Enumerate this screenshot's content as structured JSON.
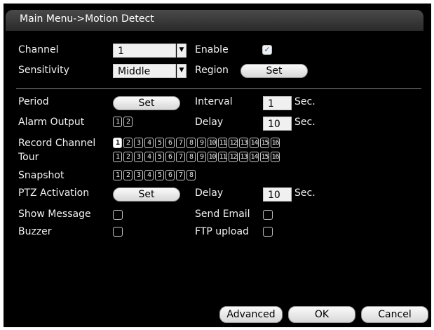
{
  "window": {
    "title": "Main Menu->Motion Detect"
  },
  "labels": {
    "channel": "Channel",
    "enable": "Enable",
    "sensitivity": "Sensitivity",
    "region": "Region",
    "period": "Period",
    "interval": "Interval",
    "alarm_output": "Alarm Output",
    "delay": "Delay",
    "record_channel": "Record Channel",
    "tour": "Tour",
    "snapshot": "Snapshot",
    "ptz_activation": "PTZ Activation",
    "delay2": "Delay",
    "show_message": "Show Message",
    "send_email": "Send Email",
    "buzzer": "Buzzer",
    "ftp_upload": "FTP upload",
    "sec": "Sec."
  },
  "fields": {
    "channel": "1",
    "sensitivity": "Middle",
    "interval": "1",
    "delay": "10",
    "ptz_delay": "10"
  },
  "buttons": {
    "region_set": "Set",
    "period_set": "Set",
    "ptz_set": "Set",
    "advanced": "Advanced",
    "ok": "OK",
    "cancel": "Cancel"
  },
  "checkboxes": {
    "enable": true,
    "show_message": false,
    "send_email": false,
    "buzzer": false,
    "ftp_upload": false
  },
  "alarm_outputs": [
    "1",
    "2"
  ],
  "record_channels": [
    "1",
    "2",
    "3",
    "4",
    "5",
    "6",
    "7",
    "8",
    "9",
    "10",
    "11",
    "12",
    "13",
    "14",
    "15",
    "16"
  ],
  "record_selected": [
    "1"
  ],
  "tour_channels": [
    "1",
    "2",
    "3",
    "4",
    "5",
    "6",
    "7",
    "8",
    "9",
    "10",
    "11",
    "12",
    "13",
    "14",
    "15",
    "16"
  ],
  "snapshot_channels": [
    "1",
    "2",
    "3",
    "4",
    "5",
    "6",
    "7",
    "8"
  ],
  "icons": {
    "dropdown": "chevron-down-icon",
    "check": "checkmark-icon"
  }
}
